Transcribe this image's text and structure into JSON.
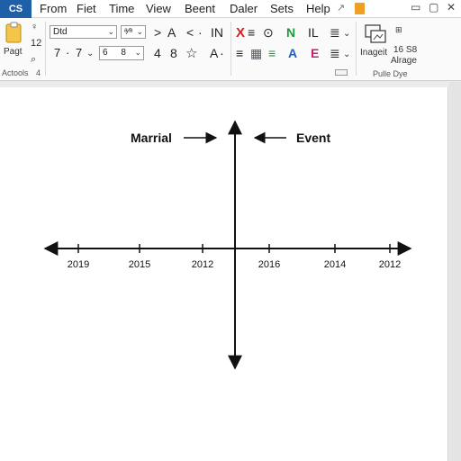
{
  "app": {
    "badge": "CS"
  },
  "menu": {
    "items": [
      "From",
      "Fiet",
      "Time",
      "View",
      "Beent",
      "Daler",
      "Sets",
      "Help"
    ],
    "share_icon": "arrow-icon",
    "accent_icon_color": "#f0a020"
  },
  "window_controls": [
    "▭",
    "▢",
    "✕"
  ],
  "ribbon": {
    "paste": {
      "label": "Pagt",
      "icon": "clipboard-icon"
    },
    "actions_label": "Actools",
    "actions_count": "4",
    "left_symbols": [
      "♀",
      "12",
      "⌕"
    ],
    "font_combo": "Dtd",
    "font_size_combo": "ᵃ⁄ᵃ",
    "size_row": [
      "7",
      "·",
      "7"
    ],
    "size_row2": [
      "6",
      "8"
    ],
    "row1_symbols": [
      ">",
      "A",
      "<",
      "·",
      "IN"
    ],
    "row2_symbols": [
      "4",
      "8",
      "☆",
      "A",
      "·"
    ],
    "para_row1": [
      "X",
      "≡",
      "⊙",
      "N",
      "IL",
      "≣"
    ],
    "para_row2": [
      "≡",
      "▦",
      "≡",
      "A",
      "E",
      "≣"
    ],
    "insert_label": "Inageit",
    "size_label_top": "16 S8",
    "size_label_bottom": "Alrage",
    "group_label": "Pulle Dye"
  },
  "colors": {
    "badge_bg": "#1f5fa8",
    "red_icon": "#d32020",
    "green_icon": "#1e9a3a",
    "blue_icon": "#2060c0",
    "magenta_icon": "#c02070",
    "orange_icon": "#f0a020"
  },
  "chart_data": {
    "type": "timeline",
    "labels": {
      "left": "Marrial",
      "right": "Event"
    },
    "x_ticks_left": [
      "2019",
      "2015",
      "2012"
    ],
    "x_ticks_right": [
      "2016",
      "2014",
      "2012"
    ],
    "axes": {
      "horizontal_arrows": "both",
      "vertical_arrows": "both"
    }
  }
}
